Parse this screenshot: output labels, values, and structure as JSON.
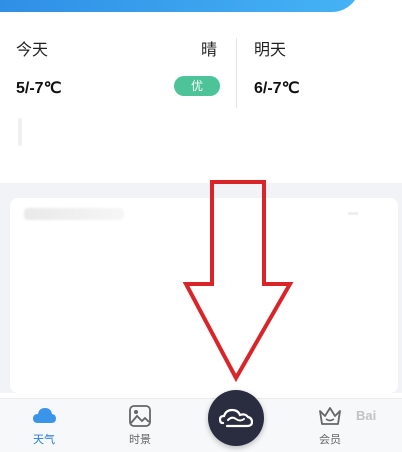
{
  "forecast": {
    "today": {
      "label": "今天",
      "condition": "晴",
      "temp": "5/-7℃",
      "aqi": "优",
      "aqi_color": "#4dc39a"
    },
    "tomorrow": {
      "label": "明天",
      "temp": "6/-7℃"
    }
  },
  "tabbar": {
    "tabs": [
      {
        "label": "天气",
        "icon": "cloud-icon",
        "active": true
      },
      {
        "label": "时景",
        "icon": "image-icon",
        "active": false
      },
      {
        "label": "会员",
        "icon": "crown-icon",
        "active": false
      }
    ],
    "center_icon": "cloud-swirl-icon"
  },
  "colors": {
    "accent": "#1f7fe0",
    "arrow": "#d9252a",
    "center_button": "#2a2d40"
  },
  "watermark": "Bai"
}
